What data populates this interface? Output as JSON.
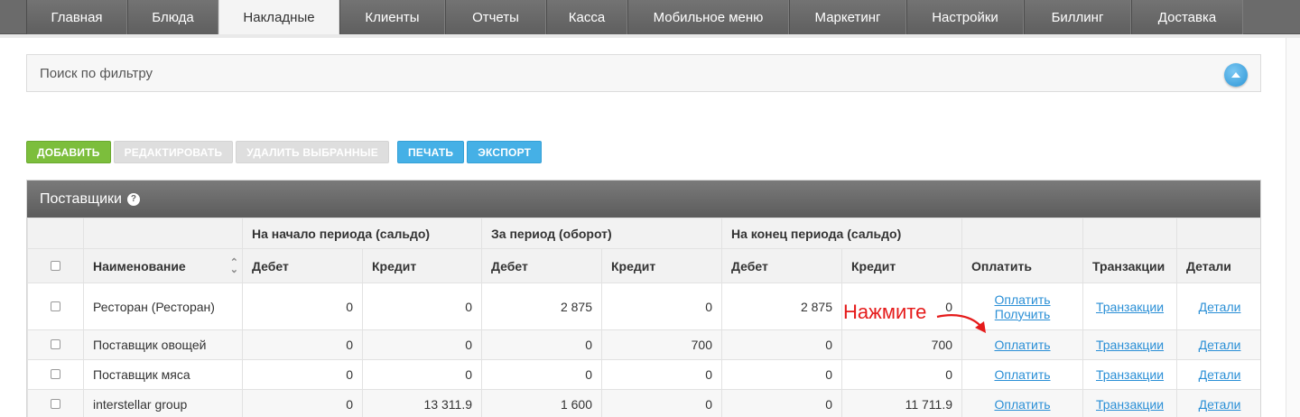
{
  "nav": {
    "tabs": [
      {
        "label": "Главная",
        "w": 112
      },
      {
        "label": "Блюда",
        "w": 101
      },
      {
        "label": "Накладные",
        "w": 134
      },
      {
        "label": "Клиенты",
        "w": 117
      },
      {
        "label": "Отчеты",
        "w": 112
      },
      {
        "label": "Касса",
        "w": 90
      },
      {
        "label": "Мобильное меню",
        "w": 179
      },
      {
        "label": "Маркетинг",
        "w": 130
      },
      {
        "label": "Настройки",
        "w": 130
      },
      {
        "label": "Биллинг",
        "w": 119
      },
      {
        "label": "Доставка",
        "w": 124
      }
    ],
    "active_index": 2
  },
  "filter": {
    "label": "Поиск по фильтру"
  },
  "toolbar": {
    "add": "ДОБАВИТЬ",
    "edit": "РЕДАКТИРОВАТЬ",
    "delete": "УДАЛИТЬ ВЫБРАННЫЕ",
    "print": "ПЕЧАТЬ",
    "export": "ЭКСПОРТ"
  },
  "panel": {
    "title": "Поставщики",
    "help": "?"
  },
  "table": {
    "group_headers": {
      "start": "На начало периода (сальдо)",
      "period": "За период (оборот)",
      "end": "На конец периода (сальдо)"
    },
    "columns": {
      "name": "Наименование",
      "debit": "Дебет",
      "credit": "Кредит",
      "pay": "Оплатить",
      "transactions": "Транзакции",
      "details": "Детали"
    },
    "rows": [
      {
        "name": "Ресторан (Ресторан)",
        "v": [
          "0",
          "0",
          "2 875",
          "0",
          "2 875",
          "0"
        ],
        "pay": "Оплатить",
        "receive": "Получить",
        "tx": "Транзакции",
        "det": "Детали"
      },
      {
        "name": "Поставщик овощей",
        "v": [
          "0",
          "0",
          "0",
          "700",
          "0",
          "700"
        ],
        "pay": "Оплатить",
        "tx": "Транзакции",
        "det": "Детали"
      },
      {
        "name": "Поставщик мяса",
        "v": [
          "0",
          "0",
          "0",
          "0",
          "0",
          "0"
        ],
        "pay": "Оплатить",
        "tx": "Транзакции",
        "det": "Детали"
      },
      {
        "name": "interstellar group",
        "v": [
          "0",
          "13 311.9",
          "1 600",
          "0",
          "0",
          "11 711.9"
        ],
        "pay": "Оплатить",
        "tx": "Транзакции",
        "det": "Детали"
      }
    ]
  },
  "annotation": {
    "text": "Нажмите",
    "color": "#e51b1b"
  }
}
